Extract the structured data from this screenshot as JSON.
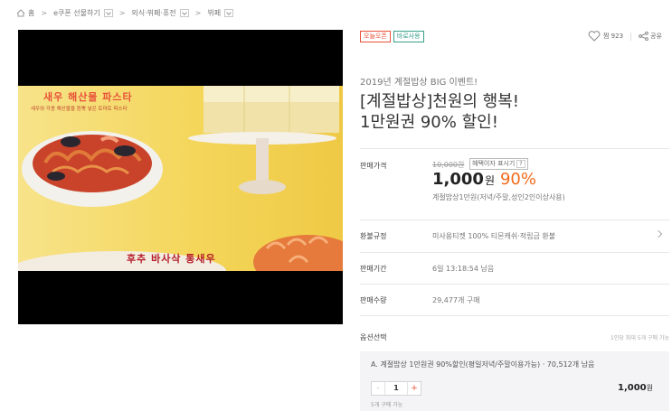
{
  "breadcrumb": {
    "home": "홈",
    "items": [
      "e쿠폰 선물하기",
      "외식·뷔페·퓨전",
      "뷔페"
    ]
  },
  "hero": {
    "banner_title": "새우 해산물 파스타",
    "banner_desc": "새우와 각종 해산물을 듬뿍 넣은 토마토 파스타",
    "banner_caption": "후추 바사삭 통새우"
  },
  "badges": [
    "오늘오픈",
    "바로사용"
  ],
  "likes": {
    "count": "찜 923",
    "share": "공유"
  },
  "product": {
    "event": "2019년 계절밥상 BIG 이벤트!",
    "title_line1": "[계절밥상]천원의 행복!",
    "title_line2": "1만원권 90% 할인!"
  },
  "price": {
    "label": "판매가격",
    "original": "10,000원",
    "show_button": "혜택이자 표시기",
    "show_help": "?",
    "amount": "1,000",
    "unit": "원",
    "discount": "90%",
    "subtitle": "계절밥상1만원(저녁/주말,성인2인이상사용)"
  },
  "rows": [
    {
      "label": "환불규정",
      "value": "미사용티켓 100% 티몬캐쉬·적립금 환불"
    },
    {
      "label": "판매기간",
      "value": "6일 13:18:54 남음"
    },
    {
      "label": "판매수량",
      "value": "29,477개 구매"
    },
    {
      "label": "옵션선택",
      "value": ""
    }
  ],
  "option": {
    "limit_note": "1인당 최대 5개 구매 가능",
    "name": "A. 계절밥상 1만원권 90%할인(평일저녁/주말이용가능) · 70,512개 남음",
    "quantity": "1",
    "minus": "-",
    "plus": "+",
    "price": "1,000",
    "price_unit": "원",
    "max_note": "5개 구매 가능"
  },
  "colors": {
    "accent": "#f26b1d",
    "badge_red": "#e8513a",
    "badge_green": "#39a08a"
  }
}
